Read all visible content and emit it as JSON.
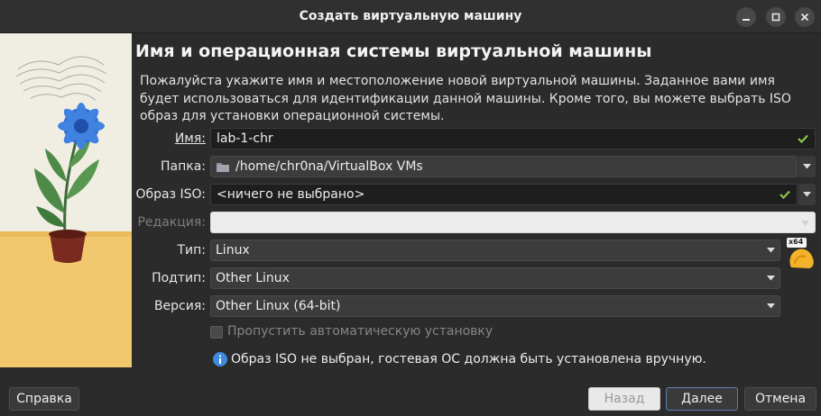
{
  "window": {
    "title": "Создать виртуальную машину"
  },
  "page": {
    "heading": "Имя и операционная системы виртуальной машины",
    "description": "Пожалуйста укажите имя и местоположение новой виртуальной машины. Заданное вами имя будет использоваться для идентификации данной машины. Кроме того, вы можете выбрать ISO образ для установки операционной системы."
  },
  "form": {
    "name": {
      "label": "Имя:",
      "value": "lab-1-chr"
    },
    "folder": {
      "label": "Папка:",
      "value": "/home/chr0na/VirtualBox VMs"
    },
    "iso": {
      "label": "Образ ISO:",
      "value": "<ничего не выбрано>"
    },
    "edition": {
      "label": "Редакция:",
      "value": ""
    },
    "type": {
      "label": "Тип:",
      "value": "Linux"
    },
    "subtype": {
      "label": "Подтип:",
      "value": "Other Linux"
    },
    "version": {
      "label": "Версия:",
      "value": "Other Linux (64-bit)"
    },
    "os_badge": "x64",
    "skip_unattended": {
      "label": "Пропустить автоматическую установку",
      "checked": false
    },
    "info_message": "Образ ISO не выбран, гостевая ОС должна быть установлена вручную."
  },
  "buttons": {
    "help": "Справка",
    "back": "Назад",
    "next": "Далее",
    "cancel": "Отмена"
  },
  "colors": {
    "window_bg": "#2b2b2b",
    "check_green": "#8bc34a",
    "info_blue": "#3d8be0"
  }
}
